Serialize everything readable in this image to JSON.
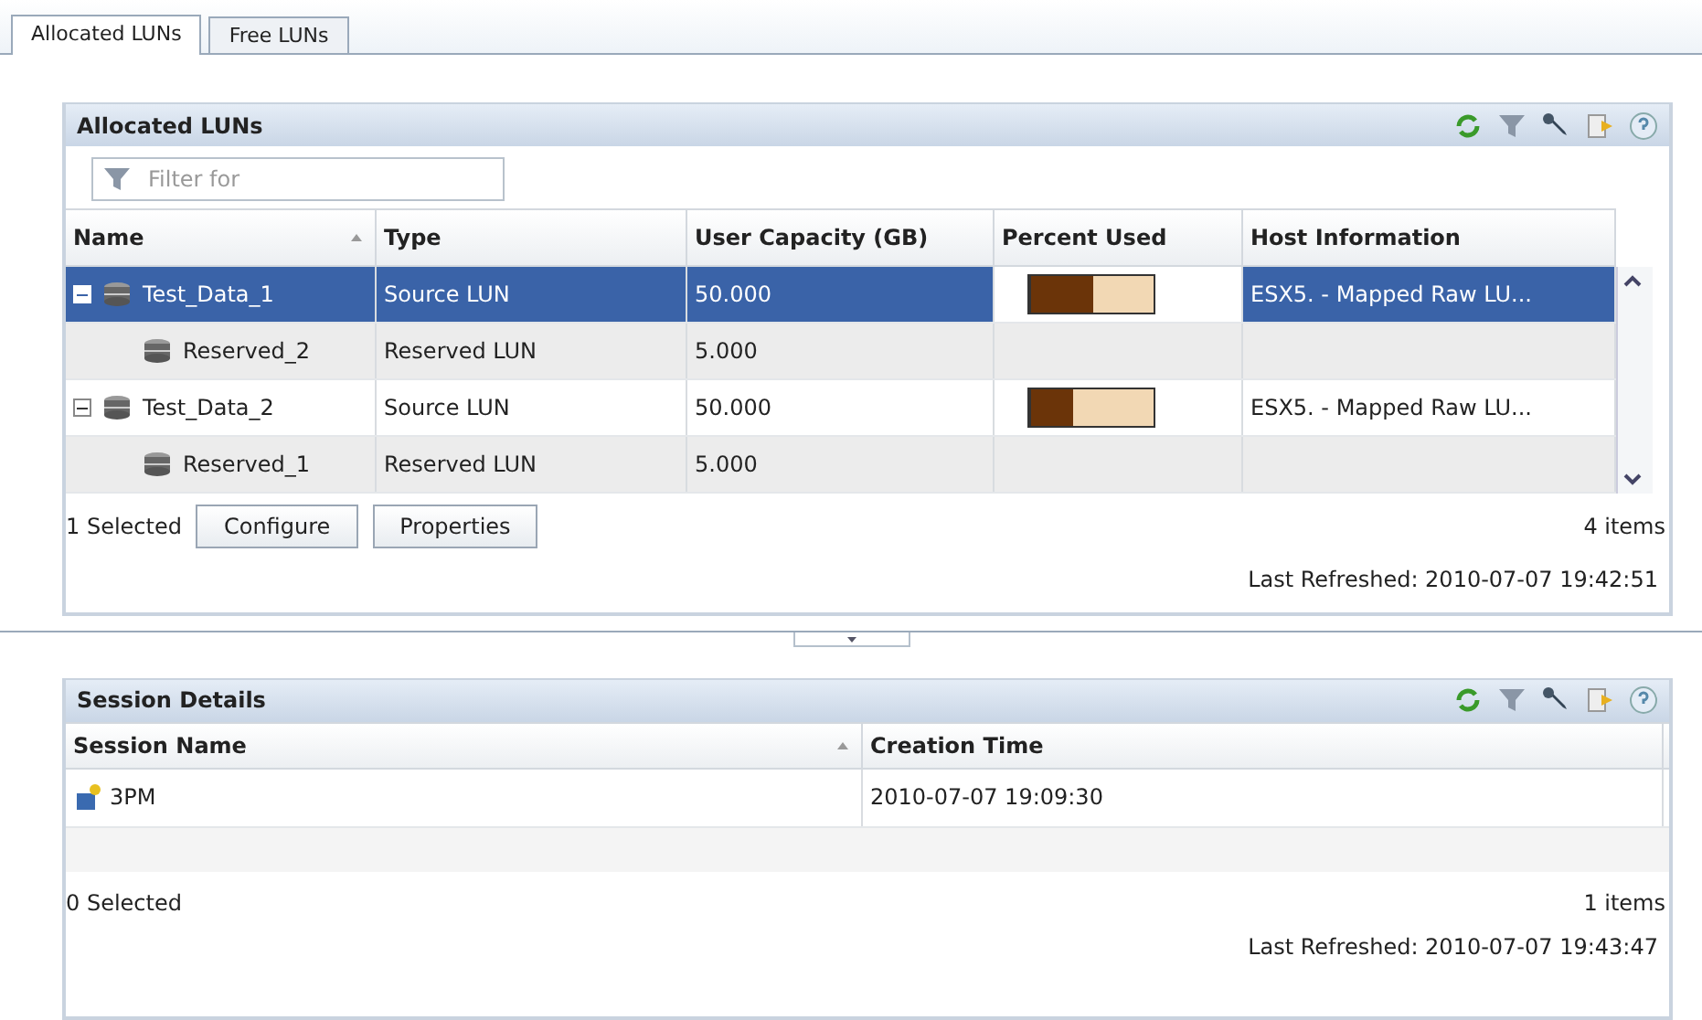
{
  "tabs": [
    {
      "label": "Allocated LUNs",
      "selected": true
    },
    {
      "label": "Free LUNs",
      "selected": false
    }
  ],
  "luns_panel": {
    "title": "Allocated LUNs",
    "filter": {
      "placeholder": "Filter for"
    },
    "columns": [
      {
        "label": "Name",
        "sorted": true
      },
      {
        "label": "Type",
        "sorted": false
      },
      {
        "label": "User Capacity (GB)",
        "sorted": false
      },
      {
        "label": "Percent Used",
        "sorted": false
      },
      {
        "label": "Host Information",
        "sorted": false
      }
    ],
    "rows": [
      {
        "name": "Test_Data_1",
        "type": "Source LUN",
        "capacity": "50.000",
        "level": 0.5,
        "host": "ESX5. - Mapped Raw LU...",
        "selected": true,
        "expanded": true,
        "children": [
          {
            "name": "Reserved_2",
            "type": "Reserved LUN",
            "capacity": "5.000",
            "selected": false
          }
        ]
      },
      {
        "name": "Test_Data_2",
        "type": "Source LUN",
        "capacity": "50.000",
        "level": 0.34,
        "host": "ESX5. - Mapped Raw LU...",
        "selected": false,
        "expanded": true,
        "children": [
          {
            "name": "Reserved_1",
            "type": "Reserved LUN",
            "capacity": "5.000",
            "selected": false
          }
        ]
      }
    ],
    "selected_count": "1 Selected",
    "buttons": [
      "Configure",
      "Properties"
    ],
    "item_count": "4 items",
    "last_refreshed": "Last Refreshed: 2010-07-07 19:42:51"
  },
  "session_panel": {
    "title": "Session Details",
    "columns": [
      {
        "label": "Session Name",
        "sorted": true
      },
      {
        "label": "Creation Time",
        "sorted": false
      }
    ],
    "rows": [
      {
        "name": "3PM",
        "time": "2010-07-07 19:09:30"
      }
    ],
    "selected_count": "0 Selected",
    "item_count": "1 items",
    "last_refreshed": "Last Refreshed: 2010-07-07 19:43:47"
  }
}
